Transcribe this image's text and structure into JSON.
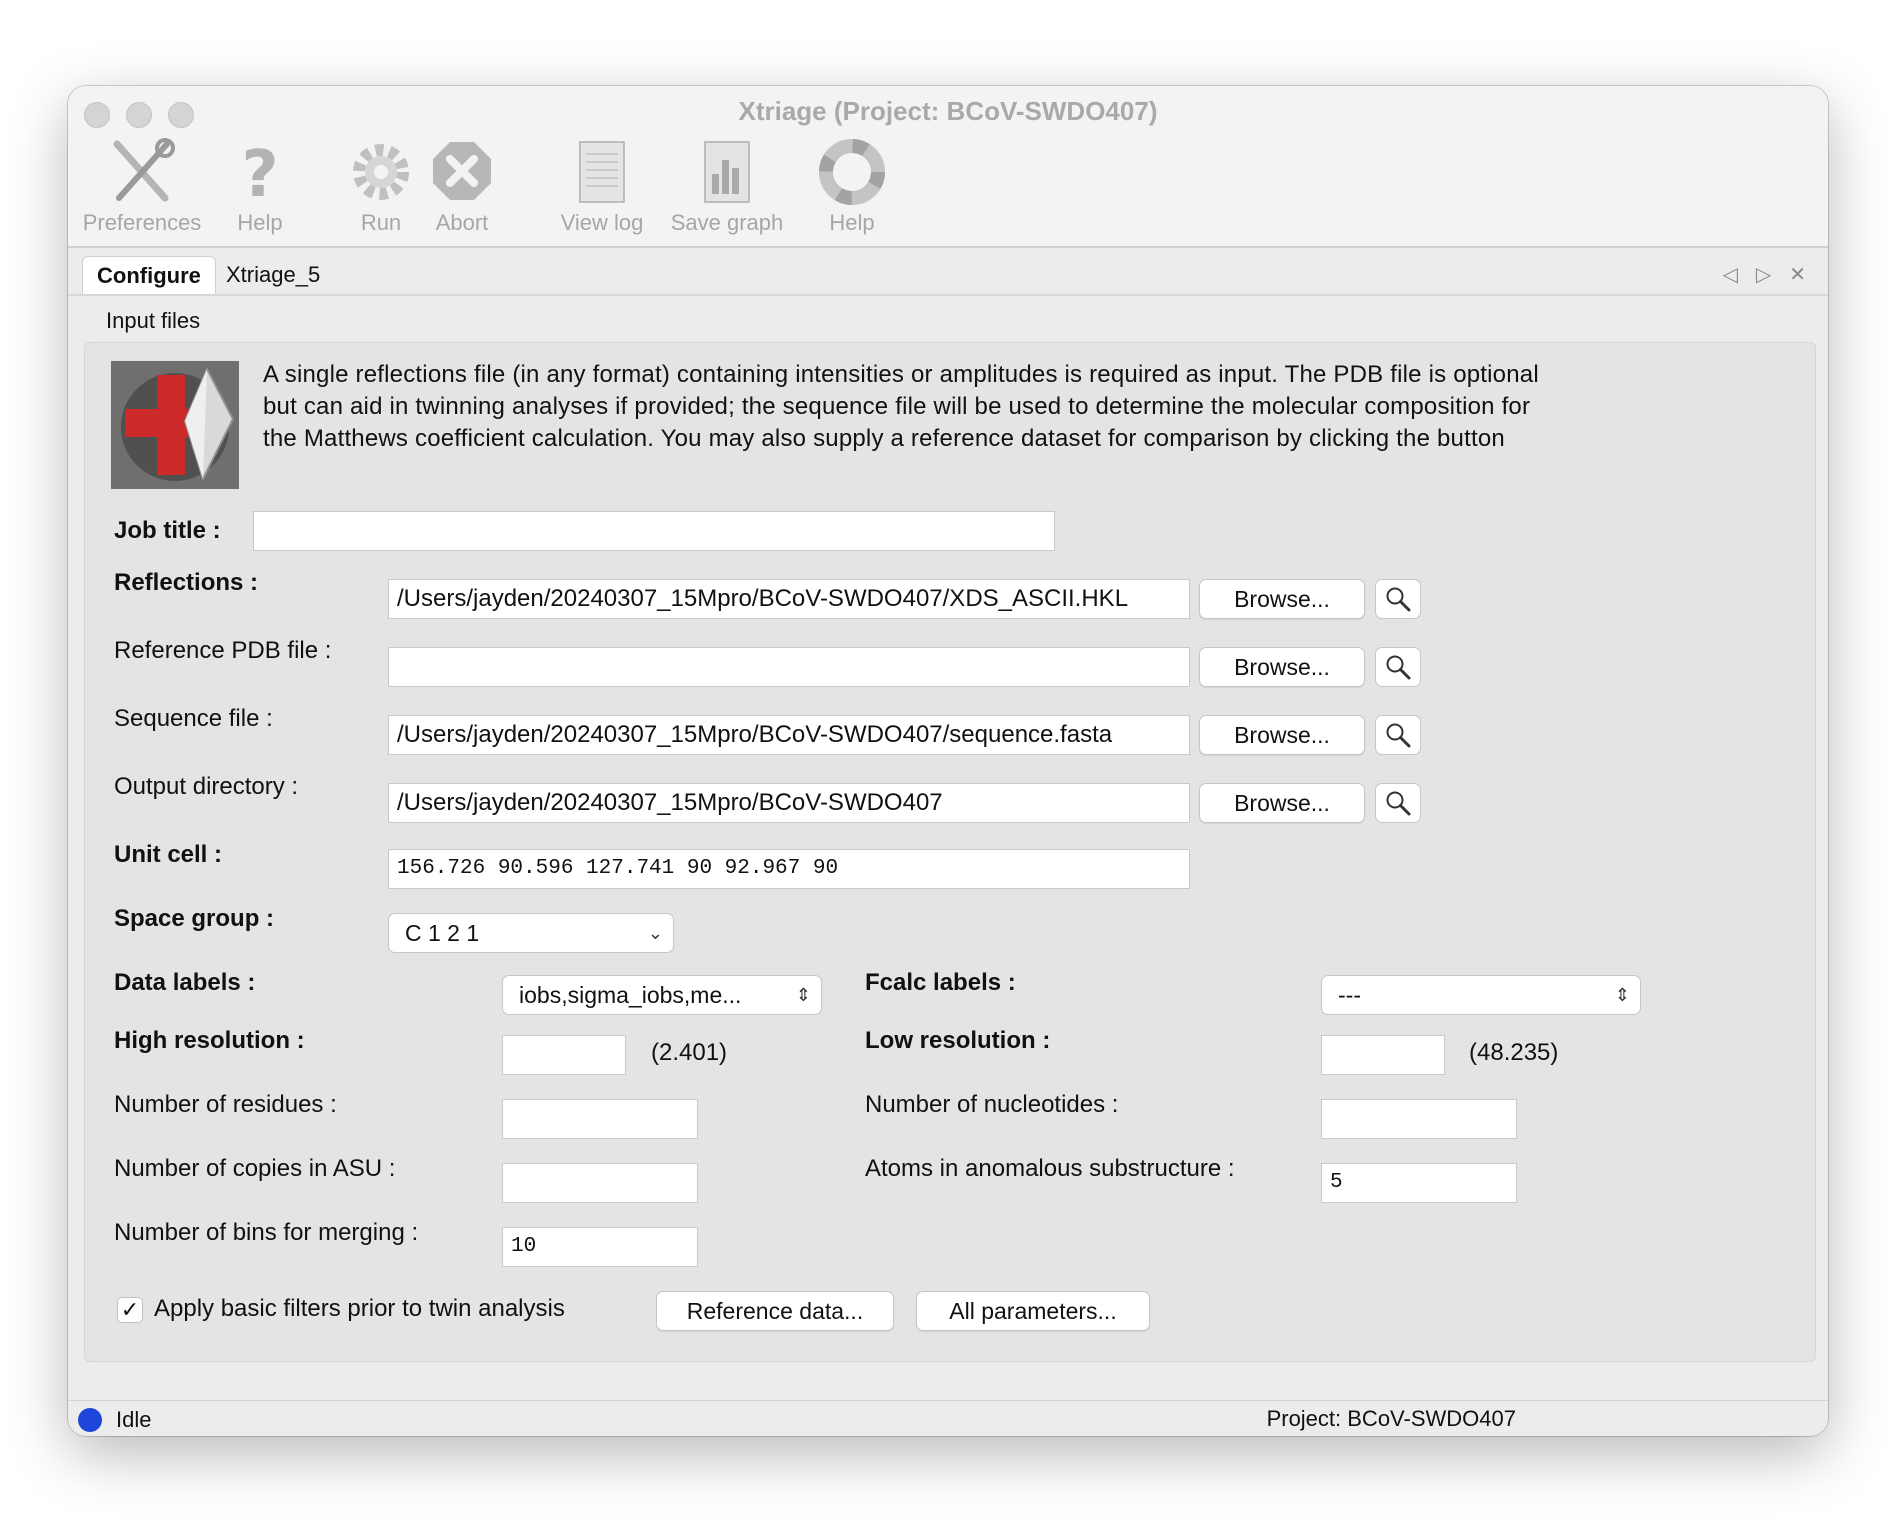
{
  "window": {
    "title": "Xtriage (Project: BCoV-SWDO407)"
  },
  "toolbar": [
    {
      "label": "Preferences",
      "icon": "preferences-tools-icon"
    },
    {
      "label": "Help",
      "icon": "help-question-icon"
    },
    {
      "label": "Run",
      "icon": "run-gear-icon"
    },
    {
      "label": "Abort",
      "icon": "abort-x-icon"
    },
    {
      "label": "View log",
      "icon": "view-log-icon"
    },
    {
      "label": "Save graph",
      "icon": "save-graph-icon"
    },
    {
      "label": "Help",
      "icon": "help-lifebuoy-icon"
    }
  ],
  "tabs": [
    {
      "label": "Configure",
      "active": true
    },
    {
      "label": "Xtriage_5",
      "active": false
    }
  ],
  "section": {
    "title": "Input files"
  },
  "description": {
    "line1": "A single reflections file (in any format) containing intensities or amplitudes is required as input.  The PDB file is optional",
    "line2": "but can aid in twinning analyses if provided; the sequence file will be used to determine the molecular composition for",
    "line3": "the Matthews coefficient calculation.  You may also supply a reference dataset for comparison by clicking the button"
  },
  "form": {
    "job_title": {
      "label": "Job title :",
      "value": ""
    },
    "reflections": {
      "label": "Reflections :",
      "value": "/Users/jayden/20240307_15Mpro/BCoV-SWDO407/XDS_ASCII.HKL"
    },
    "reference_pdb": {
      "label": "Reference PDB file :",
      "value": ""
    },
    "sequence_file": {
      "label": "Sequence file :",
      "value": "/Users/jayden/20240307_15Mpro/BCoV-SWDO407/sequence.fasta"
    },
    "output_directory": {
      "label": "Output directory :",
      "value": "/Users/jayden/20240307_15Mpro/BCoV-SWDO407"
    },
    "unit_cell": {
      "label": "Unit cell :",
      "value": "156.726 90.596 127.741 90 92.967 90"
    },
    "space_group": {
      "label": "Space group :",
      "value": "C 1 2 1"
    },
    "data_labels": {
      "label": "Data labels :",
      "value": "iobs,sigma_iobs,me..."
    },
    "fcalc_labels": {
      "label": "Fcalc labels :",
      "value": "---"
    },
    "high_resolution": {
      "label": "High resolution :",
      "value": "",
      "hint": "(2.401)"
    },
    "low_resolution": {
      "label": "Low resolution :",
      "value": "",
      "hint": "(48.235)"
    },
    "num_residues": {
      "label": "Number of residues :",
      "value": ""
    },
    "num_nucleotides": {
      "label": "Number of nucleotides :",
      "value": ""
    },
    "num_copies": {
      "label": "Number of copies in ASU :",
      "value": ""
    },
    "atoms_anomalous": {
      "label": "Atoms in anomalous substructure :",
      "value": "5"
    },
    "num_bins": {
      "label": "Number of bins for merging :",
      "value": "10"
    },
    "apply_filters": {
      "label": "Apply basic filters prior to twin analysis",
      "checked": true
    }
  },
  "buttons": {
    "browse": "Browse...",
    "reference_data": "Reference data...",
    "all_parameters": "All parameters..."
  },
  "status": {
    "state": "Idle",
    "project": "Project: BCoV-SWDO407",
    "dot_color": "#1e46d8"
  }
}
